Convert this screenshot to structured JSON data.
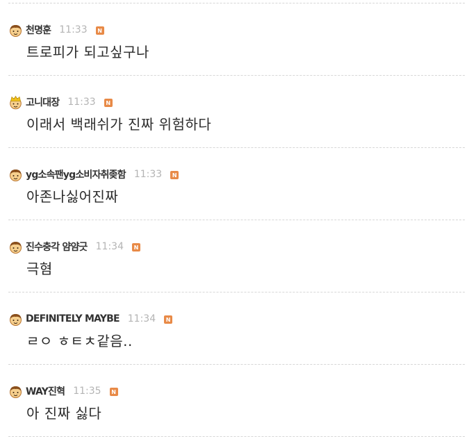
{
  "colors": {
    "badge": "#e88a47",
    "nickname": "#333333",
    "time": "#b4b4b4",
    "text": "#2b2b2b",
    "divider": "#d6d6d6"
  },
  "comments": [
    {
      "avatar": "boy-face-icon",
      "nickname": "천명훈",
      "time": "11:33",
      "badge": "N",
      "text": "트로피가 되고싶구나"
    },
    {
      "avatar": "crowned-face-icon",
      "nickname": "고니대장",
      "time": "11:33",
      "badge": "N",
      "text": "이래서 백래쉬가 진짜 위험하다"
    },
    {
      "avatar": "boy-face-icon",
      "nickname": "yg소속팬yg소비자취좆함",
      "time": "11:33",
      "badge": "N",
      "text": "아존나싫어진짜"
    },
    {
      "avatar": "boy-face-icon",
      "nickname": "진수충각 얌얌긋",
      "time": "11:34",
      "badge": "N",
      "text": "극혐"
    },
    {
      "avatar": "boy-face-icon",
      "nickname": "DEFINITELY MAYBE",
      "time": "11:34",
      "badge": "N",
      "text": "ㄹㅇ ㅎㅌㅊ같음.."
    },
    {
      "avatar": "boy-face-icon",
      "nickname": "WAY진혁",
      "time": "11:35",
      "badge": "N",
      "text": "아 진짜 싫다"
    }
  ]
}
